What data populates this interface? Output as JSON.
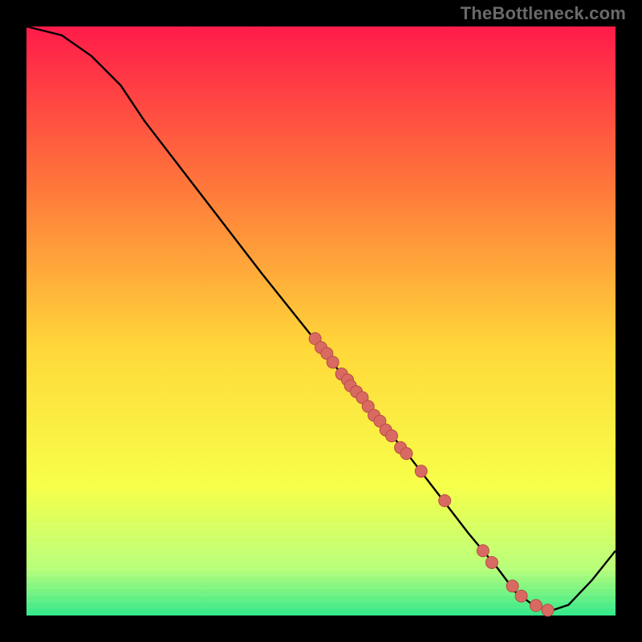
{
  "watermark": "TheBottleneck.com",
  "colors": {
    "bg_black": "#000000",
    "grad_top": "#ff1b4a",
    "grad_mid1": "#ff7a3a",
    "grad_mid2": "#ffd93a",
    "grad_mid3": "#f7ff4a",
    "grad_green1": "#b8ff7a",
    "grad_green2": "#32e88a",
    "line": "#000000",
    "dot_fill": "#d96a62",
    "dot_stroke": "#b84c44"
  },
  "chart_data": {
    "type": "line",
    "title": "",
    "xlabel": "",
    "ylabel": "",
    "xlim": [
      0,
      100
    ],
    "ylim": [
      0,
      100
    ],
    "curve": [
      {
        "x": 0,
        "y": 100
      },
      {
        "x": 6,
        "y": 98.5
      },
      {
        "x": 11,
        "y": 95
      },
      {
        "x": 16,
        "y": 90
      },
      {
        "x": 20,
        "y": 84
      },
      {
        "x": 30,
        "y": 71
      },
      {
        "x": 40,
        "y": 58
      },
      {
        "x": 50,
        "y": 45.5
      },
      {
        "x": 55,
        "y": 39
      },
      {
        "x": 60,
        "y": 33
      },
      {
        "x": 65,
        "y": 27
      },
      {
        "x": 70,
        "y": 20.5
      },
      {
        "x": 75,
        "y": 14
      },
      {
        "x": 80,
        "y": 8
      },
      {
        "x": 83,
        "y": 4
      },
      {
        "x": 86,
        "y": 1.8
      },
      {
        "x": 89,
        "y": 0.8
      },
      {
        "x": 92,
        "y": 1.8
      },
      {
        "x": 96,
        "y": 6
      },
      {
        "x": 100,
        "y": 11
      }
    ],
    "points": [
      {
        "x": 49,
        "y": 47
      },
      {
        "x": 50,
        "y": 45.5
      },
      {
        "x": 51,
        "y": 44.5
      },
      {
        "x": 52,
        "y": 43
      },
      {
        "x": 53.5,
        "y": 41
      },
      {
        "x": 54.5,
        "y": 40
      },
      {
        "x": 55,
        "y": 39
      },
      {
        "x": 56,
        "y": 38
      },
      {
        "x": 57,
        "y": 37
      },
      {
        "x": 58,
        "y": 35.5
      },
      {
        "x": 59,
        "y": 34
      },
      {
        "x": 60,
        "y": 33
      },
      {
        "x": 61,
        "y": 31.5
      },
      {
        "x": 62,
        "y": 30.5
      },
      {
        "x": 63.5,
        "y": 28.5
      },
      {
        "x": 64.5,
        "y": 27.5
      },
      {
        "x": 67,
        "y": 24.5
      },
      {
        "x": 71,
        "y": 19.5
      },
      {
        "x": 77.5,
        "y": 11
      },
      {
        "x": 79,
        "y": 9
      },
      {
        "x": 82.5,
        "y": 5
      },
      {
        "x": 84,
        "y": 3.3
      },
      {
        "x": 86.5,
        "y": 1.7
      },
      {
        "x": 88.5,
        "y": 0.9
      }
    ]
  }
}
